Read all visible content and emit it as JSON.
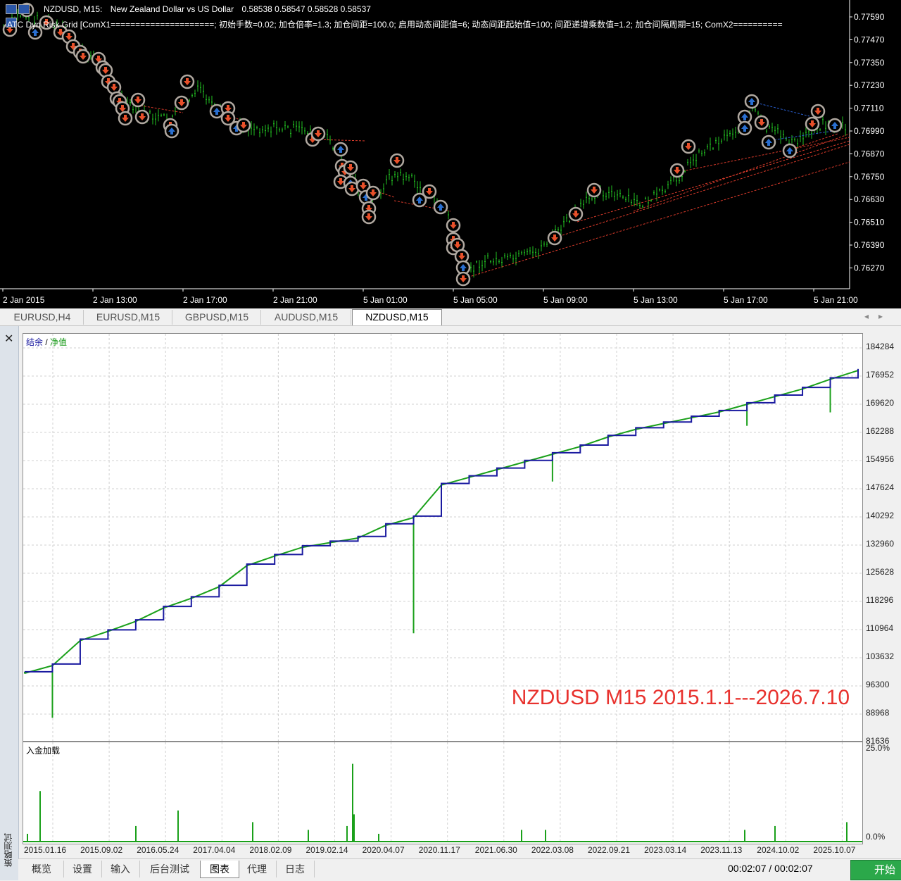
{
  "price_chart": {
    "symbol_line": [
      "NZDUSD, M15:",
      "New Zealand Dollar vs US Dollar",
      "0.58538 0.58547 0.58528 0.58537"
    ],
    "ea_line": "ATC Dyn      Risk Grid [ComX1=====================; 初始手数=0.02; 加仓倍率=1.3; 加仓间距=100.0; 启用动态间距值=6; 动态间距起始值=100; 间距递增乘数值=1.2; 加仓间隔周期=15; ComX2==========",
    "price_labels": [
      "0.77590",
      "0.77470",
      "0.77350",
      "0.77230",
      "0.77110",
      "0.76990",
      "0.76870",
      "0.76750",
      "0.76630",
      "0.76510",
      "0.76390",
      "0.76270"
    ],
    "time_labels": [
      "2 Jan 2015",
      "2 Jan 13:00",
      "2 Jan 17:00",
      "2 Jan 21:00",
      "5 Jan 01:00",
      "5 Jan 05:00",
      "5 Jan 09:00",
      "5 Jan 13:00",
      "5 Jan 17:00",
      "5 Jan 21:00"
    ],
    "colors": {
      "candle": "#22c022",
      "sell_arrow": "#e8502a",
      "buy_arrow": "#2a6fd0",
      "marker_ring": "#b0a8a0",
      "order_line_red": "#d83a2a",
      "order_line_blue": "#2a5fd0"
    }
  },
  "symbol_tabs": [
    "EURUSD,H4",
    "EURUSD,M15",
    "GBPUSD,M15",
    "AUDUSD,M15",
    "NZDUSD,M15"
  ],
  "active_symbol_tab": "NZDUSD,M15",
  "tester": {
    "side_title": "策略测试",
    "legend_balance": "结余",
    "legend_sep": " / ",
    "legend_equity": "净值",
    "watermark": "NZDUSD M15 2015.1.1---2026.7.10",
    "load_title": "入金加载",
    "equity_y_labels": [
      "184284",
      "176952",
      "169620",
      "162288",
      "154956",
      "147624",
      "140292",
      "132960",
      "125628",
      "118296",
      "110964",
      "103632",
      "96300",
      "88968",
      "81636"
    ],
    "load_y_labels": [
      "25.0%",
      "0.0%"
    ],
    "x_labels": [
      "2015.01.16",
      "2015.09.02",
      "2016.05.24",
      "2017.04.04",
      "2018.02.09",
      "2019.02.14",
      "2020.04.07",
      "2020.11.17",
      "2021.06.30",
      "2022.03.08",
      "2022.09.21",
      "2023.03.14",
      "2023.11.13",
      "2024.10.02",
      "2025.10.07"
    ],
    "bottom_tabs": [
      "概览",
      "设置",
      "输入",
      "后台测试",
      "图表",
      "代理",
      "日志"
    ],
    "active_bottom_tab": "图表",
    "timer": "00:02:07 / 00:02:07",
    "start_label": "开始",
    "colors": {
      "balance": "#1a1aa0",
      "equity": "#1aa01a",
      "load": "#1aa01a",
      "grid": "#d0d0d0"
    }
  },
  "chart_data": [
    {
      "type": "line",
      "series": [
        {
          "name": "结余",
          "values": [
            100000,
            102000,
            108500,
            110900,
            113500,
            117000,
            119500,
            122500,
            128000,
            130500,
            132800,
            134000,
            135200,
            138500,
            140500,
            149000,
            151000,
            153000,
            155000,
            157000,
            159000,
            161500,
            163500,
            165000,
            166500,
            168000,
            170000,
            172000,
            174000,
            176500,
            178800
          ]
        },
        {
          "name": "净值",
          "values": [
            99500,
            88000,
            108000,
            110500,
            113000,
            116500,
            119000,
            121500,
            127500,
            130000,
            132500,
            133500,
            134500,
            137500,
            110000,
            148500,
            150500,
            152500,
            154000,
            149500,
            158500,
            161000,
            163000,
            164500,
            166000,
            167500,
            164000,
            171500,
            173500,
            167500,
            178500
          ]
        }
      ],
      "x": [
        "2015.01.16",
        "2015.03",
        "2015.09.02",
        "2016.01",
        "2016.05.24",
        "2016.09",
        "2017.01",
        "2017.04.04",
        "2017.06",
        "2017.09",
        "2018.02.09",
        "2018.06",
        "2018.10",
        "2019.02.14",
        "2019.06",
        "2019.07",
        "2020.04.07",
        "2020.11.17",
        "2021.03",
        "2021.06.30",
        "2021.12",
        "2022.03.08",
        "2022.09.21",
        "2023.03.14",
        "2023.07",
        "2023.11.13",
        "2024.04",
        "2024.10.02",
        "2025.03",
        "2025.06",
        "2025.10.07"
      ],
      "ylim": [
        81636,
        184284
      ]
    },
    {
      "type": "bar",
      "title": "入金加载",
      "ylim": [
        0,
        25
      ],
      "x": [
        "2015.01.16",
        "2015.02",
        "2015.09.02",
        "2016.06",
        "2017.04.04",
        "2018.02.09",
        "2019.02.14",
        "2019.06",
        "2019.07",
        "2020.04.07",
        "2021.06.30",
        "2022.03.08",
        "2023.11.13",
        "2024.10.02",
        "2025.10.07"
      ],
      "values": [
        2,
        13,
        4,
        8,
        5,
        3,
        4,
        7,
        20,
        2,
        3,
        3,
        3,
        4,
        5
      ]
    }
  ]
}
